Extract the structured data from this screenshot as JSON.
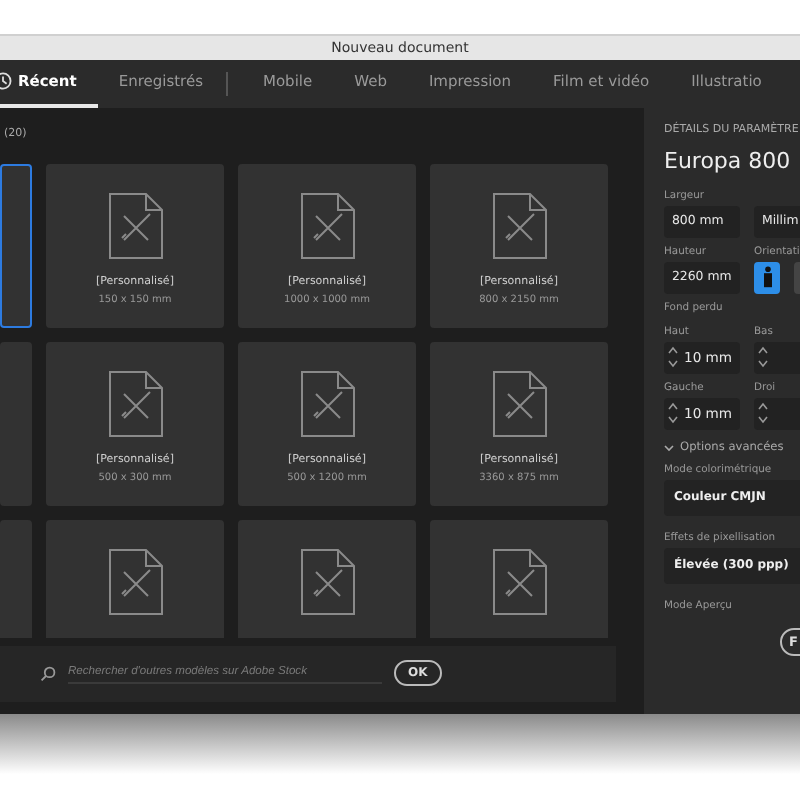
{
  "window": {
    "title": "Nouveau document"
  },
  "tabs": [
    {
      "label": "Récent",
      "selected": true,
      "kind": "recent"
    },
    {
      "label": "Enregistrés",
      "selected": false,
      "kind": "plain"
    },
    {
      "label": "Mobile",
      "selected": false,
      "kind": "plain"
    },
    {
      "label": "Web",
      "selected": false,
      "kind": "plain"
    },
    {
      "label": "Impression",
      "selected": false,
      "kind": "plain"
    },
    {
      "label": "Film et vidéo",
      "selected": false,
      "kind": "plain"
    },
    {
      "label": "Illustratio",
      "selected": false,
      "kind": "plain"
    }
  ],
  "recent": {
    "count": "(20)",
    "rows": [
      [
        {
          "selected": true
        },
        {
          "name": "[Personnalisé]",
          "size": "150 x 150 mm",
          "selected": false
        },
        {
          "name": "[Personnalisé]",
          "size": "1000 x 1000 mm",
          "selected": false
        },
        {
          "name": "[Personnalisé]",
          "size": "800 x 2150 mm",
          "selected": false
        }
      ],
      [
        {
          "selected": false
        },
        {
          "name": "[Personnalisé]",
          "size": "500 x 300 mm",
          "selected": false
        },
        {
          "name": "[Personnalisé]",
          "size": "500 x 1200 mm",
          "selected": false
        },
        {
          "name": "[Personnalisé]",
          "size": "3360 x 875 mm",
          "selected": false
        }
      ],
      [
        {
          "selected": false
        },
        {
          "selected": false
        },
        {
          "selected": false
        },
        {
          "selected": false
        }
      ]
    ]
  },
  "search": {
    "placeholder": "Rechercher d'outres modèles sur Adobe Stock",
    "button": "OK"
  },
  "details": {
    "heading": "DÉTAILS DU PARAMÈTRE",
    "name": "Europa 800",
    "width_label": "Largeur",
    "width": "800 mm",
    "unit": "Millim",
    "height_label": "Hauteur",
    "height": "2260 mm",
    "orientation_label": "Orientati",
    "portrait_selected": true,
    "bleed_label": "Fond perdu",
    "bleed": [
      {
        "label": "Haut",
        "value": "10 mm"
      },
      {
        "label": "Bas"
      },
      {
        "label": "Gauche",
        "value": "10 mm"
      },
      {
        "label": "Droi"
      }
    ],
    "advanced_label": "Options avancées",
    "advanced_expanded": true,
    "color_mode_label": "Mode colorimétrique",
    "color_mode": "Couleur CMJN",
    "raster_label": "Effets de pixellisation",
    "raster": "Élevée (300 ppp)",
    "preview_label": "Mode Aperçu",
    "action_button": "F"
  }
}
